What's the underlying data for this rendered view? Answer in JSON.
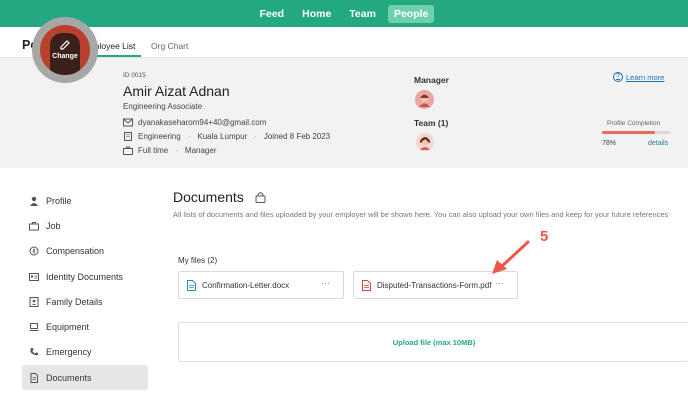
{
  "topnav": {
    "items": [
      {
        "label": "Feed",
        "active": false
      },
      {
        "label": "Home",
        "active": false
      },
      {
        "label": "Team",
        "active": false
      },
      {
        "label": "People",
        "active": true
      }
    ]
  },
  "subheader": {
    "title": "People",
    "tabs": [
      {
        "label": "Employee List",
        "active": true
      },
      {
        "label": "Org Chart",
        "active": false
      }
    ]
  },
  "profile": {
    "avatar_action": "Change",
    "id": "ID 0015",
    "name": "Amir Aizat Adnan",
    "role": "Engineering Associate",
    "email": "dyanakaseharom94+40@gmail.com",
    "department": "Engineering",
    "location": "Kuala Lumpur",
    "joined": "Joined 8 Feb 2023",
    "employment_type": "Full time",
    "position_level": "Manager",
    "manager_label": "Manager",
    "team_label": "Team (1)",
    "learn_more": "Learn more",
    "completion_label": "Profile Completion",
    "completion_percent": "78%",
    "completion_value": 0.78,
    "details_link": "details"
  },
  "sidebar": {
    "items": [
      {
        "label": "Profile",
        "icon": "person-icon"
      },
      {
        "label": "Job",
        "icon": "briefcase-icon"
      },
      {
        "label": "Compensation",
        "icon": "money-icon"
      },
      {
        "label": "Identity Documents",
        "icon": "id-card-icon"
      },
      {
        "label": "Family Details",
        "icon": "family-icon"
      },
      {
        "label": "Equipment",
        "icon": "laptop-icon"
      },
      {
        "label": "Emergency",
        "icon": "phone-icon"
      },
      {
        "label": "Documents",
        "icon": "document-icon",
        "active": true
      }
    ]
  },
  "documents": {
    "title": "Documents",
    "description": "All lists of documents and files uploaded by your employer will be shown here. You can also upload your own files and keep for your future references",
    "my_files_label": "My files (2)",
    "files": [
      {
        "name": "Confirmation-Letter.docx",
        "type": "docx"
      },
      {
        "name": "Disputed-Transactions-Form.pdf",
        "type": "pdf"
      }
    ],
    "more_label": "···",
    "upload_label": "Upload file (max 10MB)"
  },
  "annotation": {
    "step_number": "5",
    "color": "#e85a45"
  },
  "colors": {
    "brand": "#24a882",
    "active_nav": "#6fd0ad",
    "completion_bar": "#ee6b5b",
    "link": "#1d6fb0"
  }
}
